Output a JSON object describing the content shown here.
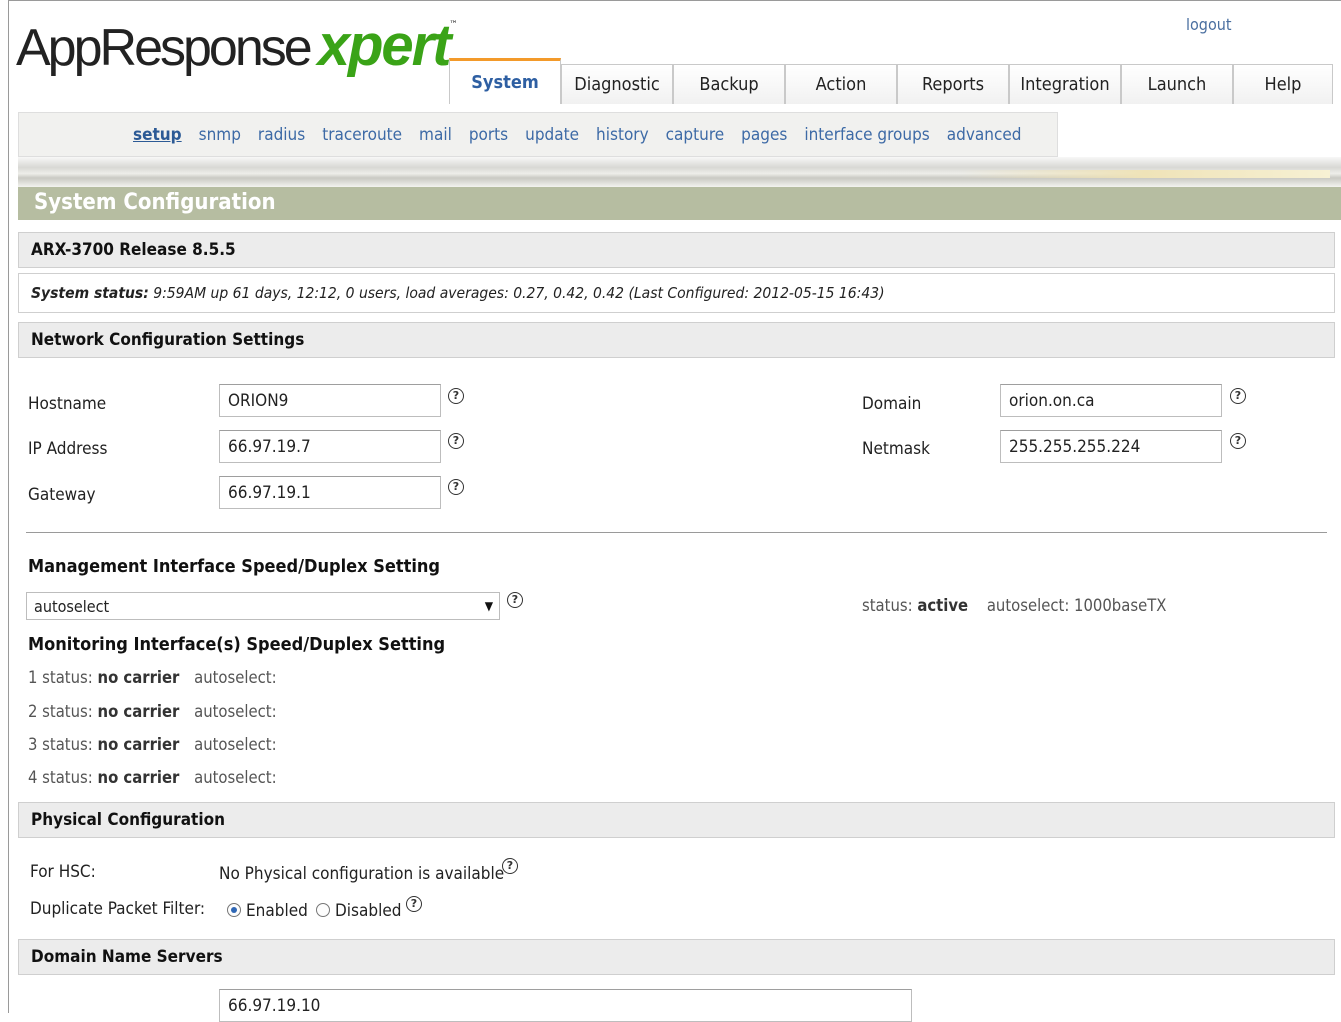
{
  "header": {
    "logo_app": "AppResponse",
    "logo_xpert": "xpert",
    "logo_tm": "™",
    "logout": "logout"
  },
  "tabs": [
    {
      "label": "System",
      "active": true
    },
    {
      "label": "Diagnostic"
    },
    {
      "label": "Backup"
    },
    {
      "label": "Action"
    },
    {
      "label": "Reports"
    },
    {
      "label": "Integration"
    },
    {
      "label": "Launch"
    },
    {
      "label": "Help"
    }
  ],
  "subnav": [
    {
      "label": "setup",
      "active": true
    },
    {
      "label": "snmp"
    },
    {
      "label": "radius"
    },
    {
      "label": "traceroute"
    },
    {
      "label": "mail"
    },
    {
      "label": "ports"
    },
    {
      "label": "update"
    },
    {
      "label": "history"
    },
    {
      "label": "capture"
    },
    {
      "label": "pages"
    },
    {
      "label": "interface groups"
    },
    {
      "label": "advanced"
    }
  ],
  "page_title": "System Configuration",
  "release": "ARX-3700 Release 8.5.5",
  "system_status": {
    "label": "System status:",
    "text": " 9:59AM up 61 days, 12:12, 0 users, load averages: 0.27, 0.42, 0.42 (Last Configured: 2012-05-15 16:43)"
  },
  "network": {
    "heading": "Network Configuration Settings",
    "hostname_label": "Hostname",
    "hostname_value": "ORION9",
    "ip_label": "IP Address",
    "ip_value": "66.97.19.7",
    "gateway_label": "Gateway",
    "gateway_value": "66.97.19.1",
    "domain_label": "Domain",
    "domain_value": "orion.on.ca",
    "netmask_label": "Netmask",
    "netmask_value": "255.255.255.224"
  },
  "management": {
    "heading": "Management Interface Speed/Duplex Setting",
    "selected": "autoselect",
    "status_label": "status:",
    "status_value": "active",
    "autoselect_text": "autoselect: 1000baseTX"
  },
  "monitoring": {
    "heading": "Monitoring Interface(s) Speed/Duplex Setting",
    "rows": [
      {
        "prefix": "1 status:",
        "status": "no carrier",
        "suffix": "autoselect:"
      },
      {
        "prefix": "2 status:",
        "status": "no carrier",
        "suffix": "autoselect:"
      },
      {
        "prefix": "3 status:",
        "status": "no carrier",
        "suffix": "autoselect:"
      },
      {
        "prefix": "4 status:",
        "status": "no carrier",
        "suffix": "autoselect:"
      }
    ]
  },
  "physical": {
    "heading": "Physical Configuration",
    "hsc_label": "For HSC:",
    "hsc_value": "No Physical configuration is available",
    "dup_label": "Duplicate Packet Filter:",
    "enabled_label": "Enabled",
    "disabled_label": "Disabled",
    "selected": "Enabled"
  },
  "dns": {
    "heading": "Domain Name Servers",
    "server1": "66.97.19.10"
  },
  "help_glyph": "?",
  "colors": {
    "accent_green": "#3aa317",
    "title_bar": "#b6bda1",
    "tab_active_top": "#f39a2a",
    "link_blue": "#3d6aa6"
  }
}
